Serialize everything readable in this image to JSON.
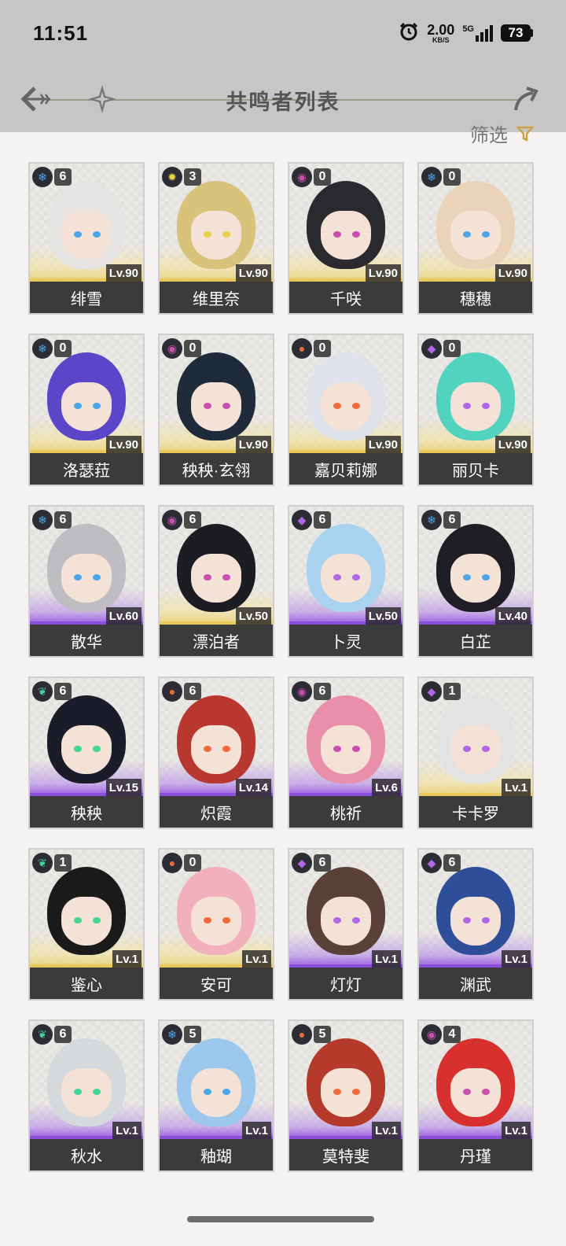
{
  "status_bar": {
    "time": "11:51",
    "net_speed": "2.00",
    "net_unit": "KB/S",
    "signal": "5G",
    "battery": "73"
  },
  "header": {
    "title": "共鸣者列表",
    "filter_label": "筛选"
  },
  "colors": {
    "glacio": "#49a7e8",
    "fusion": "#f06a3b",
    "electro": "#b266e8",
    "havoc": "#c94fb0",
    "aero": "#45d49a",
    "spectro": "#e8d04a",
    "gold_glow": "#e8c95a",
    "purple_glow": "#8c4fd9"
  },
  "characters": [
    {
      "name": "绯雪",
      "level": "Lv.90",
      "chain": "6",
      "element": "glacio",
      "rarity": "gold",
      "hair": "#e6e4e2"
    },
    {
      "name": "维里奈",
      "level": "Lv.90",
      "chain": "3",
      "element": "spectro",
      "rarity": "gold",
      "hair": "#d9c27a"
    },
    {
      "name": "千咲",
      "level": "Lv.90",
      "chain": "0",
      "element": "havoc",
      "rarity": "gold",
      "hair": "#2a2a2e"
    },
    {
      "name": "穗穗",
      "level": "Lv.90",
      "chain": "0",
      "element": "glacio",
      "rarity": "gold",
      "hair": "#ead3b8"
    },
    {
      "name": "洛瑟菈",
      "level": "Lv.90",
      "chain": "0",
      "element": "glacio",
      "rarity": "gold",
      "hair": "#5b45c9"
    },
    {
      "name": "秧秧·玄翎",
      "level": "Lv.90",
      "chain": "0",
      "element": "havoc",
      "rarity": "gold",
      "hair": "#1f2a3a"
    },
    {
      "name": "嘉贝莉娜",
      "level": "Lv.90",
      "chain": "0",
      "element": "fusion",
      "rarity": "gold",
      "hair": "#dfe2ea"
    },
    {
      "name": "丽贝卡",
      "level": "Lv.90",
      "chain": "0",
      "element": "electro",
      "rarity": "gold",
      "hair": "#52d3bf"
    },
    {
      "name": "散华",
      "level": "Lv.60",
      "chain": "6",
      "element": "glacio",
      "rarity": "purple",
      "hair": "#bdbdc2"
    },
    {
      "name": "漂泊者",
      "level": "Lv.50",
      "chain": "6",
      "element": "havoc",
      "rarity": "gold",
      "hair": "#1c1d22"
    },
    {
      "name": "卜灵",
      "level": "Lv.50",
      "chain": "6",
      "element": "electro",
      "rarity": "purple",
      "hair": "#a9d2ee"
    },
    {
      "name": "白芷",
      "level": "Lv.40",
      "chain": "6",
      "element": "glacio",
      "rarity": "purple",
      "hair": "#1e1e24"
    },
    {
      "name": "秧秧",
      "level": "Lv.15",
      "chain": "6",
      "element": "aero",
      "rarity": "purple",
      "hair": "#1a1c2a"
    },
    {
      "name": "炽霞",
      "level": "Lv.14",
      "chain": "6",
      "element": "fusion",
      "rarity": "purple",
      "hair": "#b8382f"
    },
    {
      "name": "桃祈",
      "level": "Lv.6",
      "chain": "6",
      "element": "havoc",
      "rarity": "purple",
      "hair": "#e98fab"
    },
    {
      "name": "卡卡罗",
      "level": "Lv.1",
      "chain": "1",
      "element": "electro",
      "rarity": "gold",
      "hair": "#e3e3e3"
    },
    {
      "name": "鉴心",
      "level": "Lv.1",
      "chain": "1",
      "element": "aero",
      "rarity": "gold",
      "hair": "#1a1a1a"
    },
    {
      "name": "安可",
      "level": "Lv.1",
      "chain": "0",
      "element": "fusion",
      "rarity": "gold",
      "hair": "#f2b0bd"
    },
    {
      "name": "灯灯",
      "level": "Lv.1",
      "chain": "6",
      "element": "electro",
      "rarity": "purple",
      "hair": "#5a4036"
    },
    {
      "name": "渊武",
      "level": "Lv.1",
      "chain": "6",
      "element": "electro",
      "rarity": "purple",
      "hair": "#2f4e9a"
    },
    {
      "name": "秋水",
      "level": "Lv.1",
      "chain": "6",
      "element": "aero",
      "rarity": "purple",
      "hair": "#d6d9dc"
    },
    {
      "name": "釉瑚",
      "level": "Lv.1",
      "chain": "5",
      "element": "glacio",
      "rarity": "purple",
      "hair": "#9cc8ee"
    },
    {
      "name": "莫特斐",
      "level": "Lv.1",
      "chain": "5",
      "element": "fusion",
      "rarity": "purple",
      "hair": "#b63a2c"
    },
    {
      "name": "丹瑾",
      "level": "Lv.1",
      "chain": "4",
      "element": "havoc",
      "rarity": "purple",
      "hair": "#d8302f"
    }
  ]
}
